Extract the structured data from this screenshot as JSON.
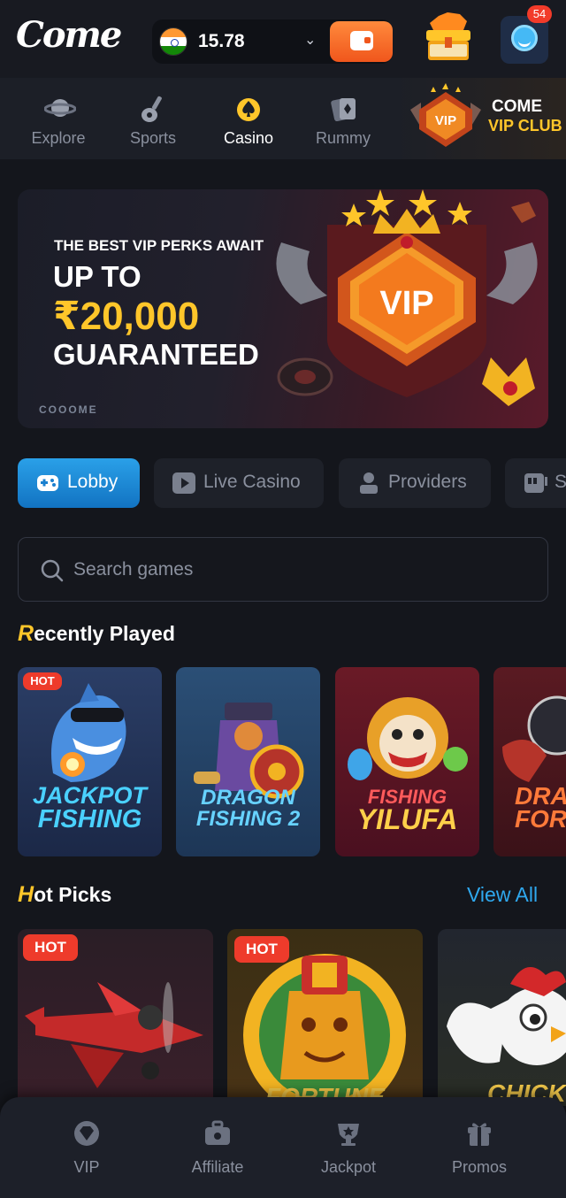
{
  "header": {
    "logo_text": "Come",
    "balance": "15.78",
    "currency_flag": "india-flag-icon",
    "notification_count": "54"
  },
  "topnav": {
    "items": [
      {
        "label": "Explore",
        "icon": "planet-icon"
      },
      {
        "label": "Sports",
        "icon": "guitar-icon"
      },
      {
        "label": "Casino",
        "icon": "spade-icon",
        "active": true
      },
      {
        "label": "Rummy",
        "icon": "cards-icon"
      }
    ],
    "vip_club": {
      "line1": "COME",
      "line2": "VIP CLUB",
      "badge_text": "VIP"
    }
  },
  "banner": {
    "kicker": "THE BEST VIP PERKS AWAIT",
    "headline1": "UP TO",
    "amount": "₹20,000",
    "headline2": "GUARANTEED",
    "brand": "COOOME",
    "badge_text": "VIP"
  },
  "tabs": [
    {
      "label": "Lobby",
      "icon": "gamepad-icon",
      "active": true
    },
    {
      "label": "Live Casino",
      "icon": "play-icon"
    },
    {
      "label": "Providers",
      "icon": "person-icon"
    },
    {
      "label": "S",
      "icon": "slot-machine-icon"
    }
  ],
  "search": {
    "placeholder": "Search games"
  },
  "recently_played": {
    "title_cap": "R",
    "title_rest": "ecently Played",
    "games": [
      {
        "title_line1": "JACKPOT",
        "title_line2": "FISHING",
        "badge": "HOT"
      },
      {
        "title_line1": "DRAGON",
        "title_line2": "FISHING 2"
      },
      {
        "title_line1": "FISHING",
        "title_line2": "YILUFA"
      },
      {
        "title_line1": "DRA",
        "title_line2": "FORT"
      }
    ]
  },
  "hot_picks": {
    "title_cap": "H",
    "title_rest": "ot Picks",
    "view_all": "View All",
    "games": [
      {
        "badge": "HOT",
        "title": ""
      },
      {
        "badge": "HOT",
        "title": "FORTUNE"
      },
      {
        "title": "CHICK"
      }
    ]
  },
  "bottomnav": {
    "items": [
      {
        "label": "VIP",
        "icon": "diamond-icon"
      },
      {
        "label": "Affiliate",
        "icon": "briefcase-icon"
      },
      {
        "label": "Jackpot",
        "icon": "trophy-icon"
      },
      {
        "label": "Promos",
        "icon": "gift-icon"
      }
    ]
  },
  "colors": {
    "background": "#14161c",
    "accent_blue": "#1f8fd8",
    "accent_orange": "#f0561c",
    "gold": "#ffc62a",
    "hot_red": "#ee3b2b"
  }
}
